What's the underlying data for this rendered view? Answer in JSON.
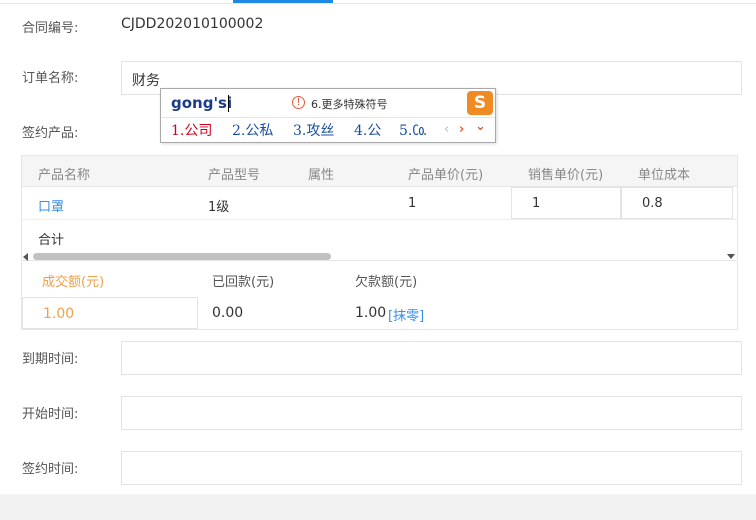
{
  "contract": {
    "no_label": "合同编号:",
    "no_value": "CJDD202010100002",
    "order_name_label": "订单名称:",
    "order_name_value": "财务",
    "product_label": "签约产品:"
  },
  "ime": {
    "pinyin": "gong'si",
    "tip_icon": "!",
    "tip_text": "6.更多特殊符号",
    "candidates": [
      "1.公司",
      "2.公私",
      "3.攻丝",
      "4.公",
      "5.㏇"
    ],
    "prev": "‹",
    "next": "›",
    "expand": "⌄",
    "logo": "S"
  },
  "table": {
    "headers": [
      "产品名称",
      "产品型号",
      "属性",
      "产品单价(元)",
      "销售单价(元)",
      "单位成本"
    ],
    "row": {
      "name": "口罩",
      "model": "1级",
      "attr": "",
      "unit_price": "1",
      "sale_price": "1",
      "unit_cost": "0.8"
    },
    "total_label": "合计"
  },
  "amounts": {
    "deal_label": "成交额(元)",
    "deal_value": "1.00",
    "paid_label": "已回款(元)",
    "paid_value": "0.00",
    "owed_label": "欠款额(元)",
    "owed_value": "1.00",
    "round_link": "[抹零]"
  },
  "dates": {
    "due_label": "到期时间:",
    "start_label": "开始时间:",
    "sign_label": "签约时间:"
  },
  "colors": {
    "accent": "#1e88e5",
    "deal_orange": "#f0a04b",
    "link_blue": "#3a8ee6"
  }
}
